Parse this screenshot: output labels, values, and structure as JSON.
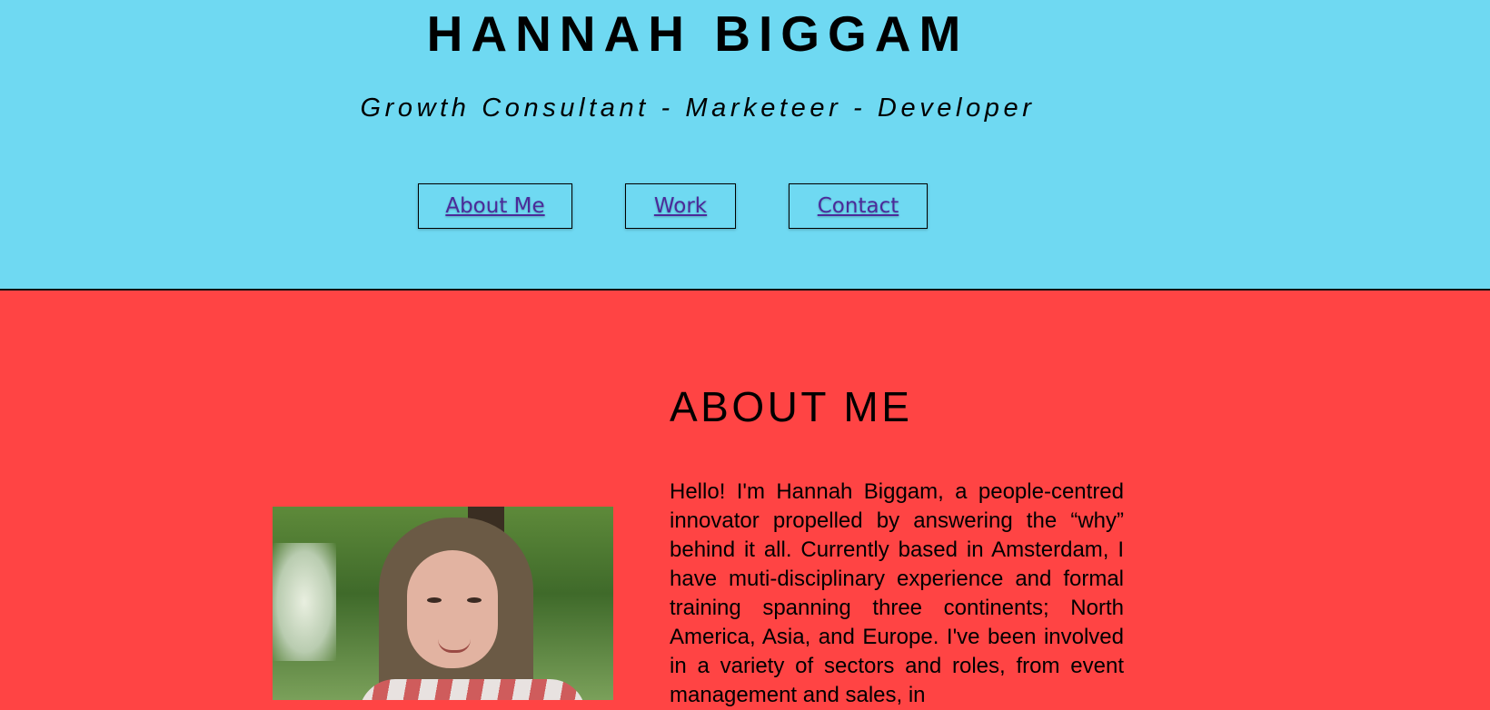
{
  "header": {
    "title": "HANNAH BIGGAM",
    "tagline": "Growth Consultant - Marketeer - Developer",
    "background_color": "#6FD9F2"
  },
  "nav": {
    "items": [
      {
        "label": "About Me"
      },
      {
        "label": "Work"
      },
      {
        "label": "Contact"
      }
    ],
    "link_color": "#4B2A9A"
  },
  "about": {
    "heading": "ABOUT ME",
    "body": "Hello! I'm Hannah Biggam, a people-centred innovator propelled by answering the “why” behind it all. Currently based in Amsterdam, I have muti-disciplinary experience and formal training spanning three continents; North America, Asia, and Europe. I've been involved in a variety of sectors and roles, from event management and sales, in",
    "background_color": "#FF4444",
    "portrait_alt": "portrait-photo"
  }
}
